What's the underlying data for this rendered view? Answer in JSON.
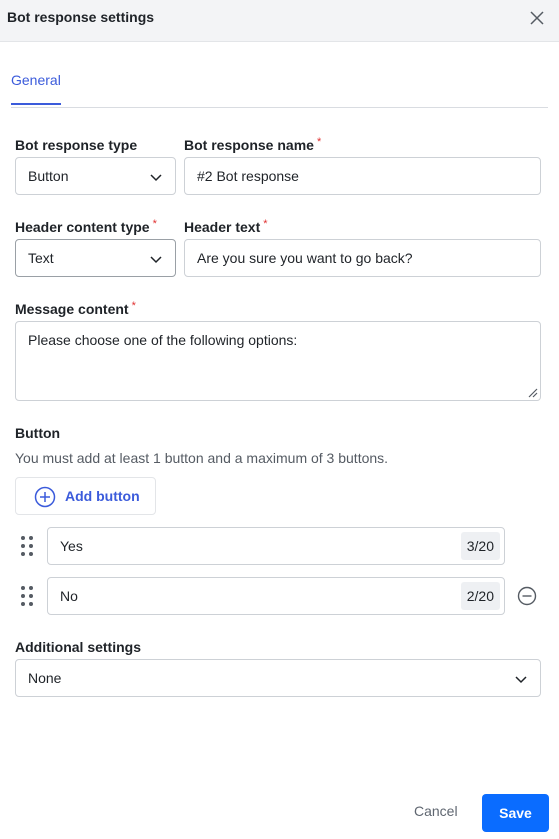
{
  "header": {
    "title": "Bot response settings",
    "close_icon": "close-icon"
  },
  "tabs": [
    {
      "label": "General",
      "active": true
    }
  ],
  "form": {
    "response_type": {
      "label": "Bot response type",
      "value": "Button"
    },
    "response_name": {
      "label": "Bot response name",
      "required_mark": "*",
      "value": "#2 Bot response"
    },
    "header_content_type": {
      "label": "Header content type",
      "required_mark": "*",
      "value": "Text"
    },
    "header_text": {
      "label": "Header text",
      "required_mark": "*",
      "value": "Are you sure you want to go back?"
    },
    "message_content": {
      "label": "Message content",
      "required_mark": "*",
      "value": "Please choose one of the following options:"
    },
    "button_section": {
      "label": "Button",
      "helper": "You must add at least 1 button and a maximum of 3 buttons.",
      "add_label": "Add button",
      "items": [
        {
          "value": "Yes",
          "counter": "3/20"
        },
        {
          "value": "No",
          "counter": "2/20"
        }
      ]
    },
    "additional_settings": {
      "label": "Additional settings",
      "value": "None"
    }
  },
  "footer": {
    "cancel_label": "Cancel",
    "save_label": "Save"
  },
  "colors": {
    "accent": "#3b5bdb",
    "primary_button": "#0a6cff",
    "required": "#e03131"
  }
}
